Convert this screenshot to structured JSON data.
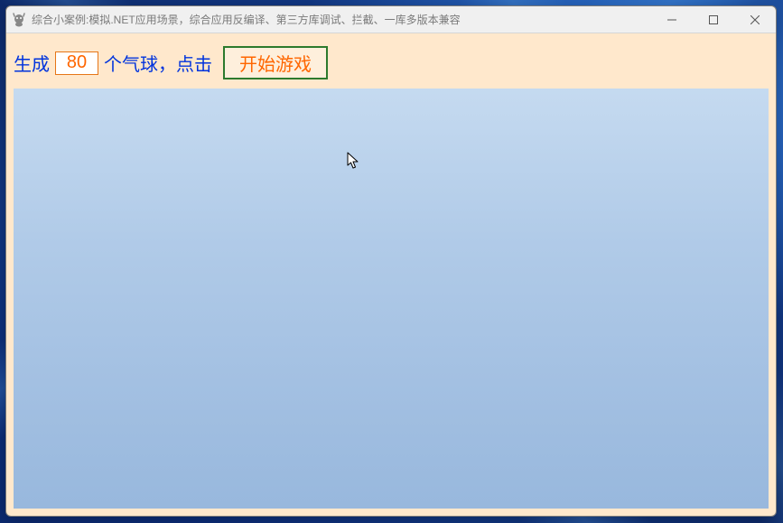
{
  "window": {
    "title": "综合小案例:模拟.NET应用场景，综合应用反编译、第三方库调试、拦截、一库多版本兼容"
  },
  "toolbar": {
    "label_before": "生成",
    "count_value": "80",
    "label_after": "个气球，点击",
    "start_button": "开始游戏"
  }
}
